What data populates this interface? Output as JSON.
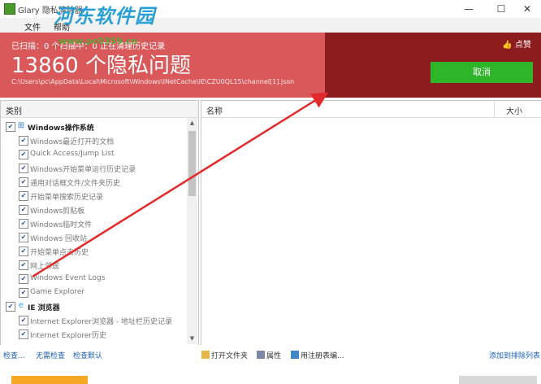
{
  "window": {
    "title": "Glary 隐私清除器",
    "app_name_prefix": "Glary",
    "minimize": "—",
    "maximize": "☐",
    "close": "✕"
  },
  "watermark": {
    "text": "河东软件园",
    "url": "www.pc0359.cn"
  },
  "menu": {
    "items": [
      "文件",
      "帮助"
    ]
  },
  "banner": {
    "stat_line": "已扫描：0  个扫描中：0  正在清理历史记录",
    "count": "13860 个隐私问题",
    "path": "C:\\Users\\pc\\AppData\\Local\\Microsoft\\Windows\\INetCache\\IE\\CZU0QL15\\channel[1].json",
    "like_label": "点赞",
    "cancel_label": "取消",
    "color_light": "#d9585a",
    "color_dark": "#8c1c1e",
    "color_button": "#2fb52a"
  },
  "left_panel": {
    "header": "类别",
    "groups": [
      {
        "label": "Windows操作系统",
        "icon": "windows-icon",
        "items": [
          "Windows最近打开的文档",
          "Quick Access/Jump List",
          "Windows开始菜单运行历史记录",
          "通用对话框文件/文件夹历史",
          "开始菜单搜索历史记录",
          "Windows剪贴板",
          "Windows临时文件",
          "Windows 回收站",
          "开始菜单点击历史",
          "网上邻居",
          "Windows Event Logs",
          "Game Explorer"
        ]
      },
      {
        "label": "IE 浏览器",
        "icon": "ie-icon",
        "items": [
          "Internet Explorer浏览器 - 地址栏历史记录",
          "Internet Explorer历史"
        ]
      }
    ]
  },
  "right_panel": {
    "columns": [
      "名称",
      "大小"
    ]
  },
  "bottom": {
    "links": [
      "检查...",
      "无需检查",
      "检查默认"
    ],
    "tools": [
      "打开文件夹",
      "属性",
      "用注册表编..."
    ],
    "right_link": "添加到排除列表"
  }
}
